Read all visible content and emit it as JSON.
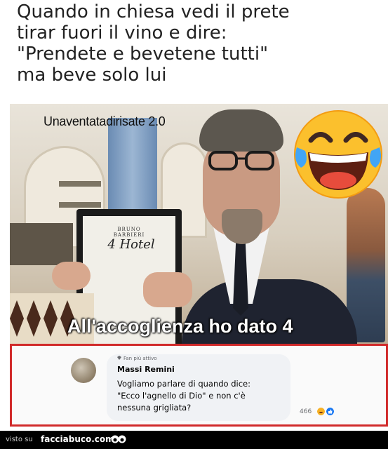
{
  "caption": {
    "lines": [
      "Quando in chiesa vedi il prete",
      "tirar fuori il vino e dire:",
      "\"Prendete e bevetene tutti\"",
      "ma beve solo lui"
    ]
  },
  "photo": {
    "watermark": "Unaventatadirisate 2.0",
    "board_brand": "BRUNO BARBIERI",
    "board_text": "4 Hotel",
    "caption": "All'accoglienza ho dato 4"
  },
  "comment": {
    "badge": "Fan più attivo",
    "author": "Massi Remini",
    "text_lines": [
      "Vogliamo parlare di quando dice:",
      "\"Ecco l'agnello di Dio\" e non c'è",
      "nessuna grigliata?"
    ],
    "reaction_count": "466",
    "reaction_icons": [
      "laugh-reaction-icon",
      "like-reaction-icon"
    ],
    "border_color": "#d12a2a"
  },
  "footer": {
    "visto_su": "visto su",
    "site": "facciabuco.com"
  }
}
